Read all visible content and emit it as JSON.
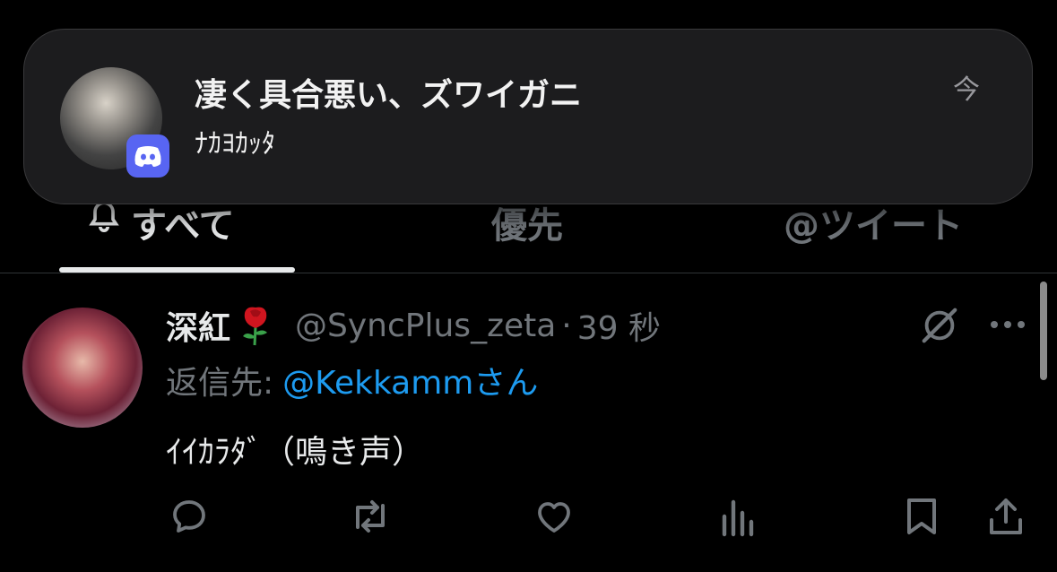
{
  "tabs": {
    "all": "すべて",
    "priority": "優先",
    "mentions": "@ツイート"
  },
  "notification": {
    "app_icon": "discord-icon",
    "title": "凄く具合悪い、ズワイガニ",
    "body": "ﾅｶﾖｶｯﾀ",
    "time": "今"
  },
  "tweet": {
    "display_name": "深紅",
    "emoji": "rose",
    "handle": "@SyncPlus_zeta",
    "separator": "·",
    "time": "39 秒",
    "reply_label": "返信先:",
    "reply_mention": "@Kekkammさん",
    "text": "ｲｲｶﾗﾀﾞ（鳴き声）"
  },
  "actions": [
    "reply-icon",
    "retweet-icon",
    "like-icon",
    "views-icon",
    "bookmark-icon",
    "share-icon"
  ],
  "colors": {
    "accent": "#1d9bf0",
    "muted": "#71767b",
    "discord": "#5865f2"
  }
}
